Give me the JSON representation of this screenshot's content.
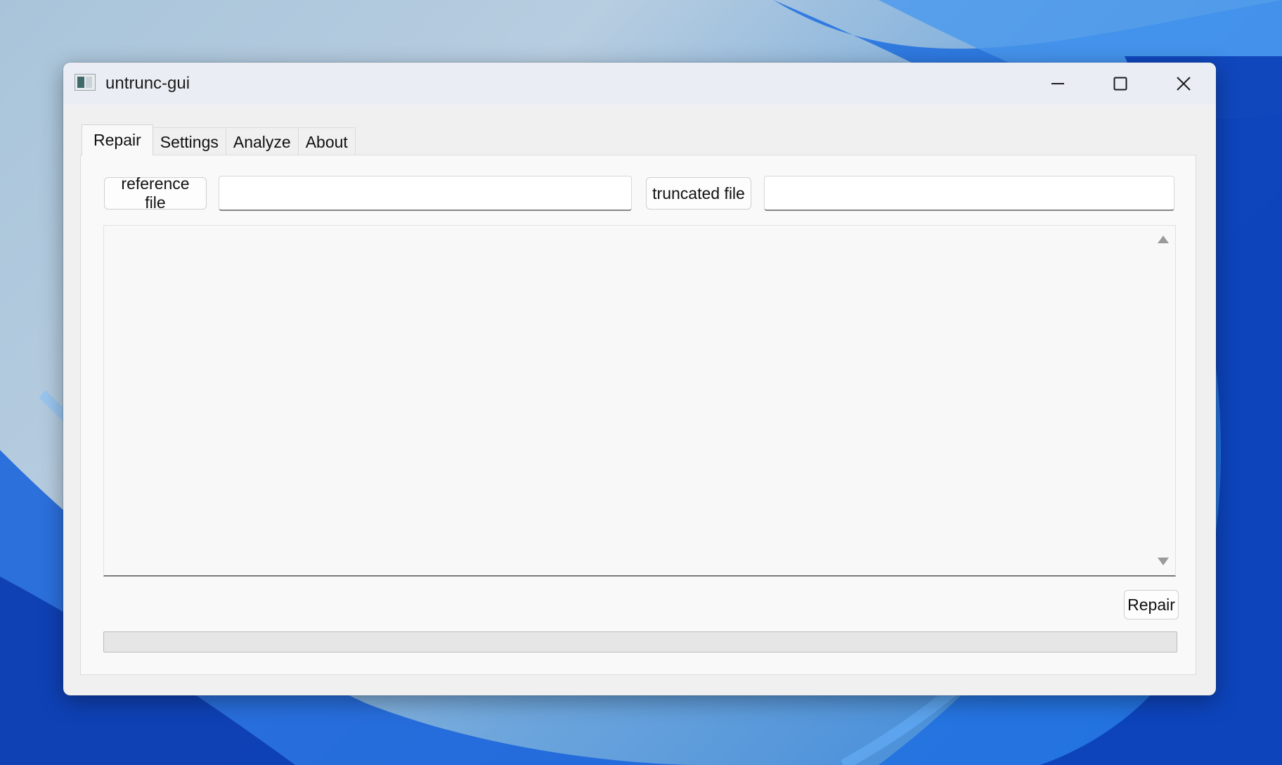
{
  "window": {
    "title": "untrunc-gui"
  },
  "titlebar_buttons": [
    "minimize-icon",
    "maximize-icon",
    "close-icon"
  ],
  "tabs": [
    {
      "label": "Repair",
      "active": true
    },
    {
      "label": "Settings",
      "active": false
    },
    {
      "label": "Analyze",
      "active": false
    },
    {
      "label": "About",
      "active": false
    }
  ],
  "repair": {
    "reference_button": "reference file",
    "reference_value": "",
    "truncated_button": "truncated file",
    "truncated_value": "",
    "log_text": "",
    "repair_button": "Repair",
    "progress": 0
  },
  "colors": {
    "accent": "#0067c0",
    "progress_fill": "#06b025"
  }
}
